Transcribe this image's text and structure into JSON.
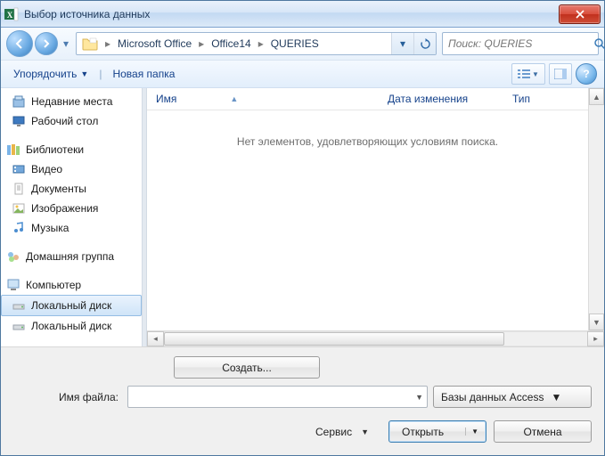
{
  "title": "Выбор источника данных",
  "breadcrumb": {
    "b1": "Microsoft Office",
    "b2": "Office14",
    "b3": "QUERIES"
  },
  "search": {
    "placeholder": "Поиск: QUERIES"
  },
  "toolbar": {
    "organize": "Упорядочить",
    "new_folder": "Новая папка"
  },
  "nav": {
    "recent": "Недавние места",
    "desktop": "Рабочий стол",
    "libraries": "Библиотеки",
    "videos": "Видео",
    "documents": "Документы",
    "pictures": "Изображения",
    "music": "Музыка",
    "homegroup": "Домашняя группа",
    "computer": "Компьютер",
    "local1": "Локальный диск",
    "local2": "Локальный диск"
  },
  "columns": {
    "name": "Имя",
    "date": "Дата изменения",
    "type": "Тип"
  },
  "empty": "Нет элементов, удовлетворяющих условиям поиска.",
  "create_btn": "Создать...",
  "filename_label": "Имя файла:",
  "filetype": "Базы данных Access",
  "service": "Сервис",
  "open": "Открыть",
  "cancel": "Отмена",
  "help_glyph": "?"
}
